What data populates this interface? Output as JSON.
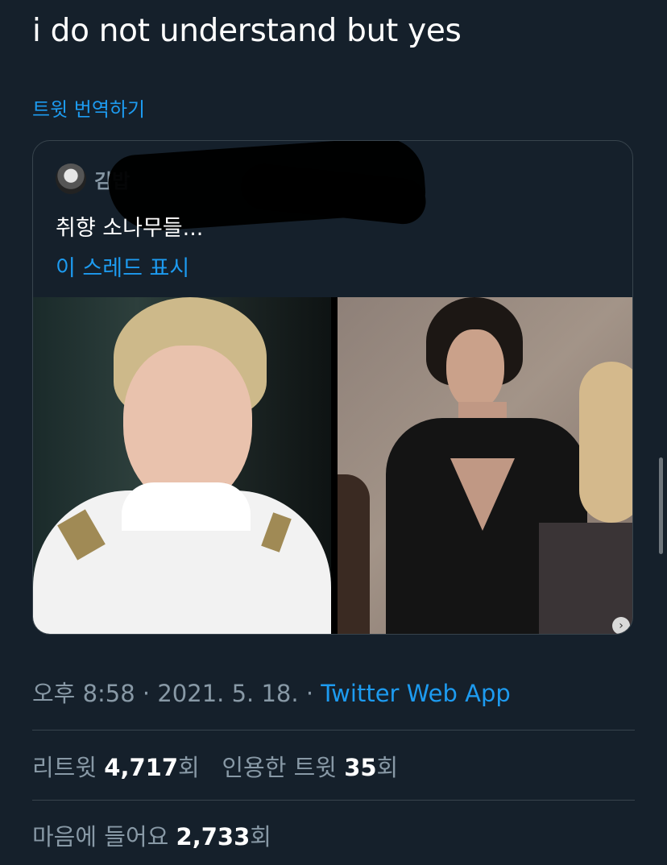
{
  "tweet": {
    "text": "i do not understand but yes",
    "translate_label": "트윗 번역하기"
  },
  "quoted_tweet": {
    "author_name": "김밥",
    "text": "취향 소나무들...",
    "show_thread_label": "이 스레드 표시"
  },
  "meta": {
    "time": "오후 8:58",
    "separator": "·",
    "date": "2021. 5. 18.",
    "source": "Twitter Web App"
  },
  "stats": {
    "retweets_label": "리트윗",
    "retweets_count": "4,717",
    "retweets_unit": "회",
    "quotes_label": "인용한 트윗",
    "quotes_count": "35",
    "quotes_unit": "회",
    "likes_label": "마음에 들어요",
    "likes_count": "2,733",
    "likes_unit": "회"
  },
  "colors": {
    "background": "#15202b",
    "accent": "#1d9bf0",
    "secondary_text": "#8899a6",
    "border": "#38444d"
  },
  "icons": {
    "carousel_next": "chevron-right-icon"
  }
}
